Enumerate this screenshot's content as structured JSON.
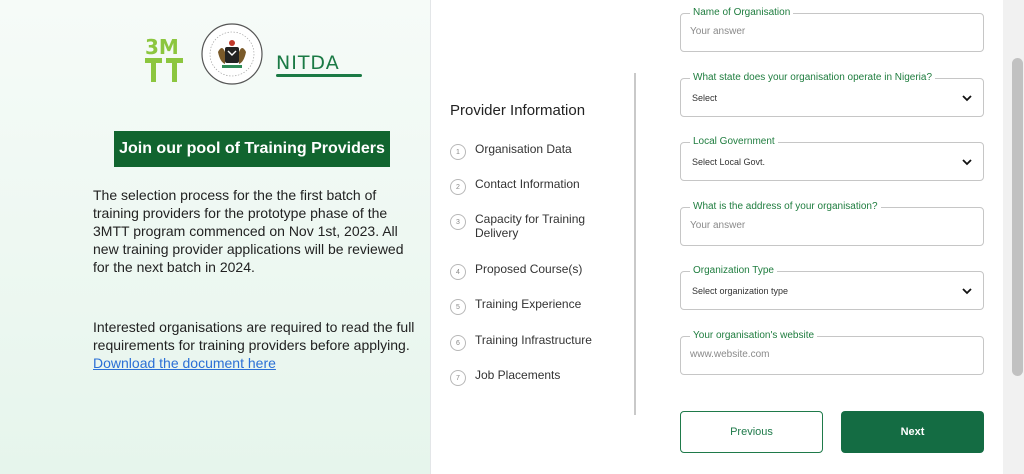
{
  "brand": {
    "logo_3mtt_text": "3M TT",
    "seal_name": "Federal Ministry of Communications, Innovation & Digital Economy",
    "nitda_text": "NITDA",
    "accent": "#11652f"
  },
  "left": {
    "banner": "Join our pool of Training Providers",
    "paragraph1": "The selection process for the the first batch of training providers for the prototype phase of the 3MTT program commenced on Nov 1st, 2023. All new training provider applications will be reviewed for the next batch in 2024.",
    "paragraph2": "Interested organisations are required to read the full requirements for training providers before applying.",
    "download_link": " Download the document here"
  },
  "steps": {
    "title": "Provider Information",
    "items": [
      {
        "num": "1",
        "label": "Organisation Data"
      },
      {
        "num": "2",
        "label": "Contact Information"
      },
      {
        "num": "3",
        "label": "Capacity for Training Delivery"
      },
      {
        "num": "4",
        "label": "Proposed Course(s)"
      },
      {
        "num": "5",
        "label": "Training Experience"
      },
      {
        "num": "6",
        "label": "Training Infrastructure"
      },
      {
        "num": "7",
        "label": "Job Placements"
      }
    ]
  },
  "form": {
    "org_name": {
      "label": "Name of Organisation",
      "placeholder": "Your answer"
    },
    "state": {
      "label": "What state does your organisation operate in Nigeria?",
      "value": "Select"
    },
    "lga": {
      "label": "Local Government",
      "value": "Select Local Govt."
    },
    "address": {
      "label": "What is the address of your organisation?",
      "placeholder": "Your answer"
    },
    "org_type": {
      "label": "Organization Type",
      "value": "Select organization type"
    },
    "website": {
      "label": "Your organisation's website",
      "placeholder": "www.website.com"
    }
  },
  "buttons": {
    "previous": "Previous",
    "next": "Next"
  }
}
